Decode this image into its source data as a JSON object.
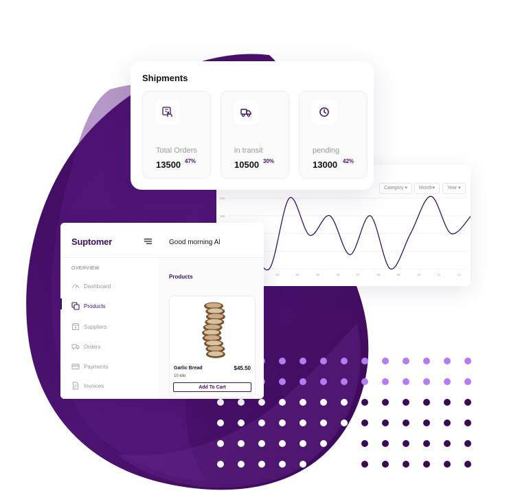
{
  "colors": {
    "brand": "#3a0f5e",
    "blob_dark": "#3d0a5c",
    "blob_mid": "#5a1a82",
    "dot_light": "#b47cf0",
    "dot_dark": "#3a0a55",
    "dot_white": "#ffffff"
  },
  "shipments": {
    "title": "Shipments",
    "stats": [
      {
        "icon": "touch-screen-icon",
        "label": "Total Orders",
        "value": "13500",
        "percent": "47%"
      },
      {
        "icon": "truck-icon",
        "label": "in transit",
        "value": "10500",
        "percent": "30%"
      },
      {
        "icon": "clock-icon",
        "label": "pending",
        "value": "13000",
        "percent": "42%"
      }
    ]
  },
  "chart_panel": {
    "filters": [
      "Category",
      "Month",
      "Year"
    ]
  },
  "chart_data": {
    "type": "line",
    "y_ticks": [
      "400",
      "300",
      "200",
      "100",
      "0"
    ],
    "x_ticks": [
      "01",
      "02",
      "03",
      "04",
      "05",
      "06",
      "07",
      "08",
      "09",
      "10",
      "11",
      "12"
    ],
    "ylim": [
      0,
      400
    ],
    "series": [
      {
        "x": [
          0,
          0.6,
          1.6,
          2.6,
          3.6,
          4.6,
          5.6,
          6.6,
          7.6,
          8.6,
          9.6,
          10.6,
          11.6
        ],
        "values": [
          200,
          160,
          0,
          400,
          190,
          300,
          80,
          300,
          0,
          200,
          410,
          200,
          300
        ]
      }
    ]
  },
  "dashboard": {
    "brand": "Suptomer",
    "section": "OVERVIEW",
    "nav": [
      {
        "label": "Dashboard",
        "icon": "dashboard-gauge-icon"
      },
      {
        "label": "Products",
        "icon": "products-copy-icon"
      },
      {
        "label": "Suppliers",
        "icon": "suppliers-store-icon"
      },
      {
        "label": "Orders",
        "icon": "orders-truck-icon"
      },
      {
        "label": "Payments",
        "icon": "payments-card-icon"
      },
      {
        "label": "Invoices",
        "icon": "invoices-document-icon"
      }
    ],
    "greeting": "Good morning Al",
    "products_title": "Products",
    "product": {
      "name": "Garlic Bread",
      "price": "$45.50",
      "quantity": "10 kilo",
      "button": "Add To Cart"
    }
  }
}
